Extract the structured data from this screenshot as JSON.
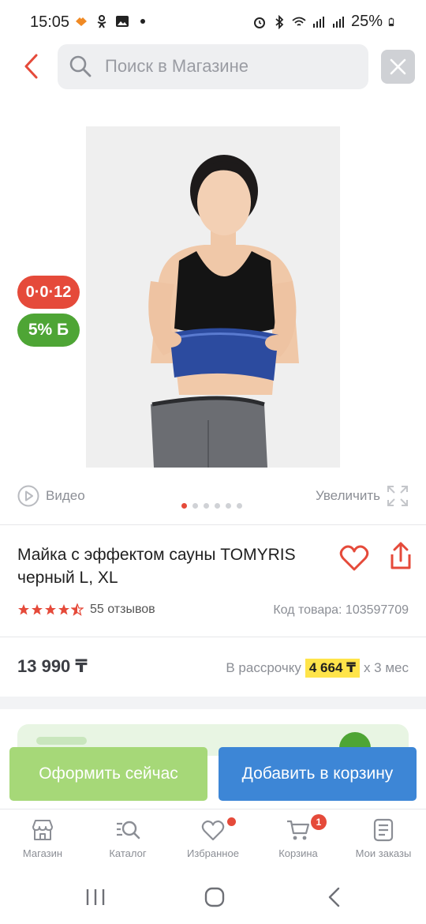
{
  "status_bar": {
    "time": "15:05",
    "battery": "25%"
  },
  "search": {
    "placeholder": "Поиск в Магазине"
  },
  "product": {
    "badges": {
      "installment": "0·0·12",
      "bonus": "5% Б"
    },
    "video_label": "Видео",
    "zoom_label": "Увеличить",
    "gallery": {
      "total": 6,
      "current": 1
    },
    "title": "Майка с эффектом сауны TOMYRIS черный L, XL",
    "rating": 4.5,
    "reviews": "55 отзывов",
    "sku": "Код товара: 103597709",
    "price": "13 990 ₸",
    "installment": {
      "prefix": "В рассрочку",
      "amount": "4 664 ₸",
      "suffix": "х 3 мес"
    }
  },
  "actions": {
    "buy_now": "Оформить сейчас",
    "add_to_cart": "Добавить в корзину"
  },
  "tabbar": {
    "items": [
      {
        "label": "Магазин",
        "icon": "store-icon"
      },
      {
        "label": "Каталог",
        "icon": "catalog-search-icon"
      },
      {
        "label": "Избранное",
        "icon": "heart-icon"
      },
      {
        "label": "Корзина",
        "icon": "cart-icon",
        "badge": "1"
      },
      {
        "label": "Мои заказы",
        "icon": "orders-icon"
      }
    ]
  },
  "colors": {
    "accent_red": "#e54a3a",
    "accent_green": "#4ea535",
    "buy_button": "#a6d878",
    "cart_button": "#3d86d6",
    "installment_highlight": "#ffe44a"
  }
}
